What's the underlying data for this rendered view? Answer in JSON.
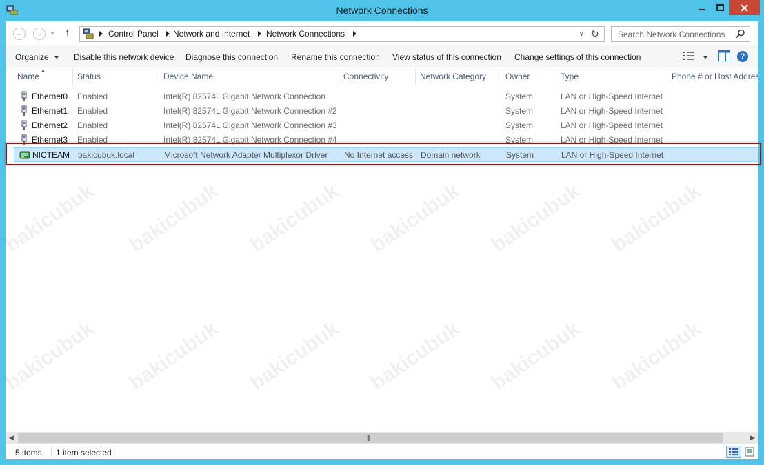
{
  "window": {
    "title": "Network Connections"
  },
  "address": {
    "breadcrumbs": [
      "Control Panel",
      "Network and Internet",
      "Network Connections"
    ]
  },
  "search": {
    "placeholder": "Search Network Connections"
  },
  "commands": {
    "organize": "Organize",
    "disable": "Disable this network device",
    "diagnose": "Diagnose this connection",
    "rename": "Rename this connection",
    "view_status": "View status of this connection",
    "change_settings": "Change settings of this connection"
  },
  "columns": [
    "Name",
    "Status",
    "Device Name",
    "Connectivity",
    "Network Category",
    "Owner",
    "Type",
    "Phone # or Host Address"
  ],
  "rows": [
    {
      "name": "Ethernet0",
      "status": "Enabled",
      "device": "Intel(R) 82574L Gigabit Network Connection",
      "connectivity": "",
      "category": "",
      "owner": "System",
      "type": "LAN or High-Speed Internet",
      "selected": false
    },
    {
      "name": "Ethernet1",
      "status": "Enabled",
      "device": "Intel(R) 82574L Gigabit Network Connection #2",
      "connectivity": "",
      "category": "",
      "owner": "System",
      "type": "LAN or High-Speed Internet",
      "selected": false
    },
    {
      "name": "Ethernet2",
      "status": "Enabled",
      "device": "Intel(R) 82574L Gigabit Network Connection #3",
      "connectivity": "",
      "category": "",
      "owner": "System",
      "type": "LAN or High-Speed Internet",
      "selected": false
    },
    {
      "name": "Ethernet3",
      "status": "Enabled",
      "device": "Intel(R) 82574L Gigabit Network Connection #4",
      "connectivity": "",
      "category": "",
      "owner": "System",
      "type": "LAN or High-Speed Internet",
      "selected": false
    },
    {
      "name": "NICTEAM",
      "status": "bakicubuk.local",
      "device": "Microsoft Network Adapter Multiplexor Driver",
      "connectivity": "No Internet access",
      "category": "Domain network",
      "owner": "System",
      "type": "LAN or High-Speed Internet",
      "selected": true
    }
  ],
  "statusbar": {
    "item_count": "5 items",
    "selected": "1 item selected"
  },
  "watermark": "bakicubuk",
  "colors": {
    "window_frame": "#4fc3e8",
    "close_button": "#c74634",
    "selection": "#cce8ff",
    "highlight_border": "#8b1a1a"
  },
  "icons": {
    "app": "network-connections-icon",
    "adapter": "ethernet-adapter-icon",
    "team": "nic-team-icon"
  }
}
